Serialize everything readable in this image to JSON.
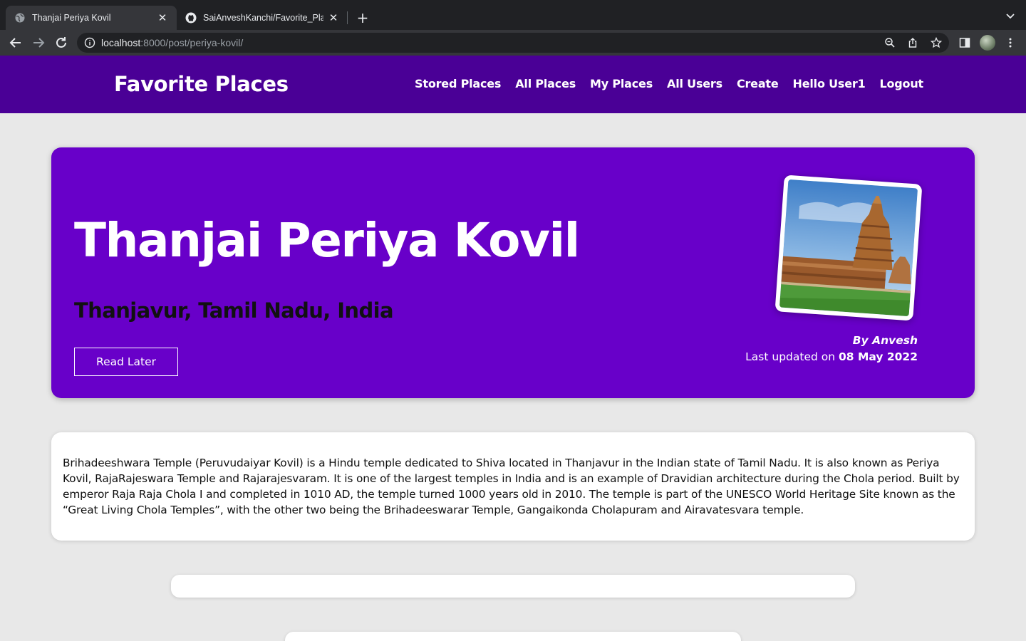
{
  "browser": {
    "tabs": [
      {
        "title": "Thanjai Periya Kovil",
        "favicon": "globe-icon",
        "active": true
      },
      {
        "title": "SaiAnveshKanchi/Favorite_Plac",
        "favicon": "github-icon",
        "active": false
      }
    ],
    "url": {
      "host": "localhost",
      "path": ":8000/post/periya-kovil/"
    }
  },
  "site": {
    "brand": "Favorite Places",
    "nav": [
      "Stored Places",
      "All Places",
      "My Places",
      "All Users",
      "Create",
      "Hello User1",
      "Logout"
    ],
    "header_color": "#4a0096"
  },
  "post": {
    "title": "Thanjai Periya Kovil",
    "location": "Thanjavur, Tamil Nadu, India",
    "read_later_label": "Read Later",
    "author": "By Anvesh",
    "updated_prefix": "Last updated on ",
    "updated_date": "08 May 2022",
    "image": "temple-photo",
    "description": "Brihadeeshwara Temple (Peruvudaiyar Kovil) is a Hindu temple dedicated to Shiva located in Thanjavur in the Indian state of Tamil Nadu. It is also known as Periya Kovil, RajaRajeswara Temple and Rajarajesvaram. It is one of the largest temples in India and is an example of Dravidian architecture during the Chola period. Built by emperor Raja Raja Chola I and completed in 1010 AD, the temple turned 1000 years old in 2010. The temple is part of the UNESCO World Heritage Site known as the “Great Living Chola Temples”, with the other two being the Brihadeeswarar Temple, Gangaikonda Cholapuram and Airavatesvara temple.",
    "hero_color": "#6800c9"
  }
}
